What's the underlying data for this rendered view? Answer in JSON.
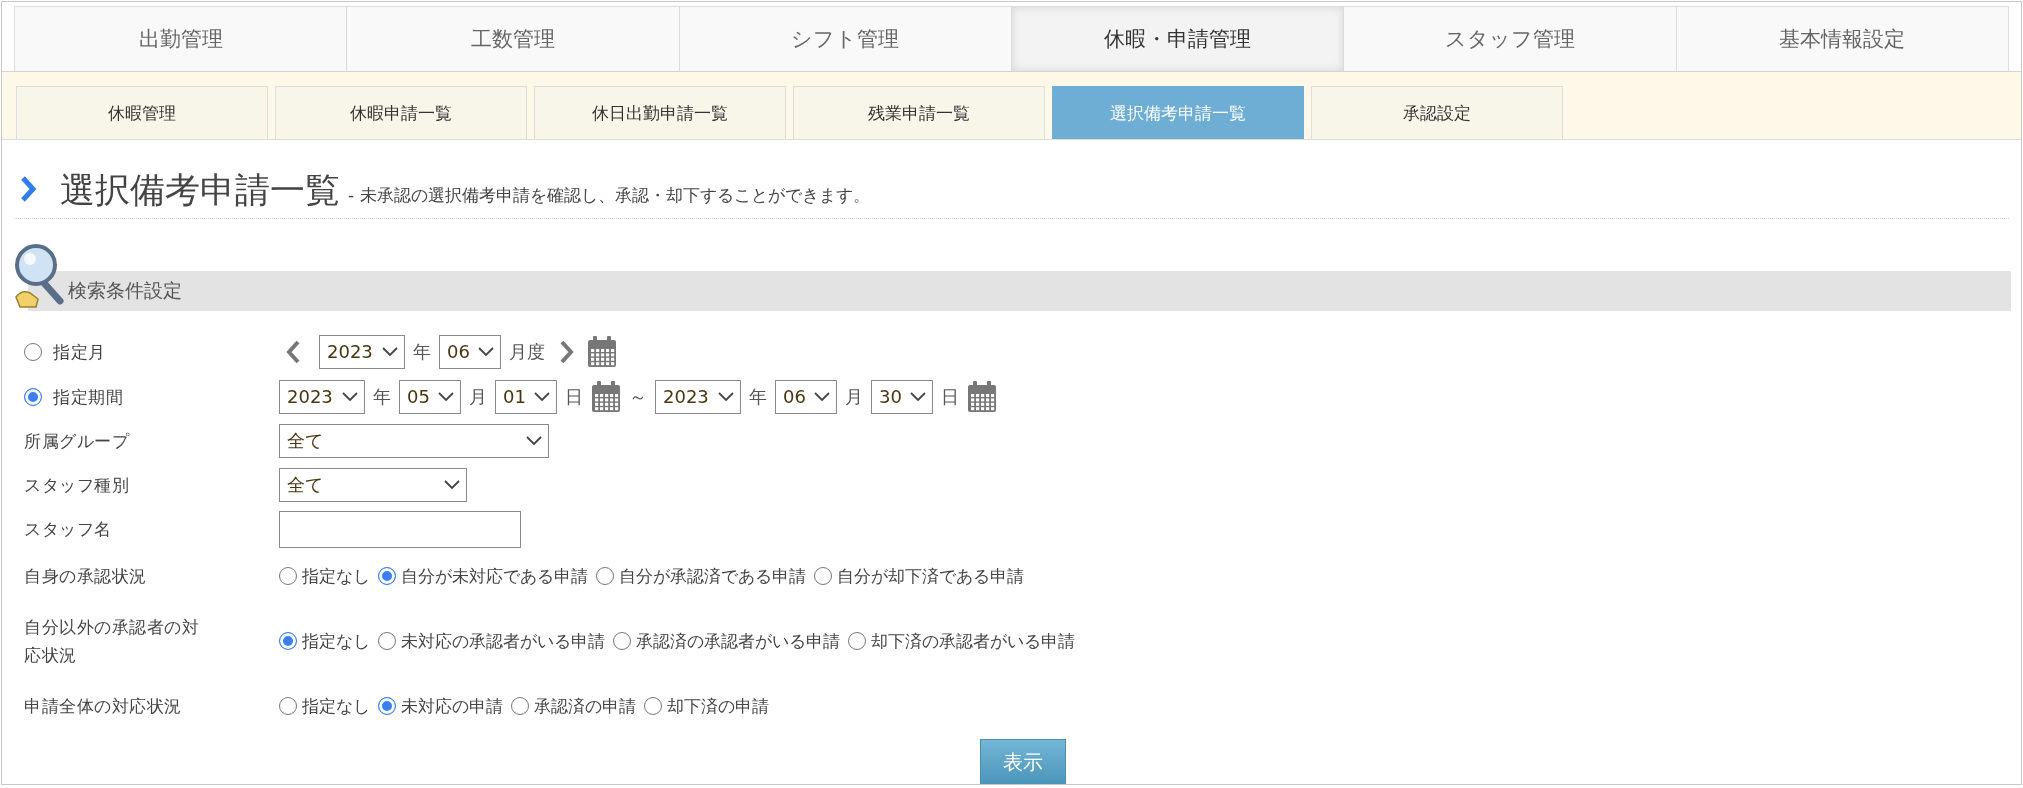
{
  "main_tabs": [
    {
      "label": "出勤管理",
      "selected": false
    },
    {
      "label": "工数管理",
      "selected": false
    },
    {
      "label": "シフト管理",
      "selected": false
    },
    {
      "label": "休暇・申請管理",
      "selected": true
    },
    {
      "label": "スタッフ管理",
      "selected": false
    },
    {
      "label": "基本情報設定",
      "selected": false
    }
  ],
  "sub_tabs": [
    {
      "label": "休暇管理",
      "selected": false
    },
    {
      "label": "休暇申請一覧",
      "selected": false
    },
    {
      "label": "休日出勤申請一覧",
      "selected": false
    },
    {
      "label": "残業申請一覧",
      "selected": false
    },
    {
      "label": "選択備考申請一覧",
      "selected": true
    },
    {
      "label": "承認設定",
      "selected": false
    }
  ],
  "page_title": "選択備考申請一覧",
  "page_description": "- 未承認の選択備考申請を確認し、承認・却下することができます。",
  "search_section": {
    "title": "検索条件設定"
  },
  "period_options": [
    {
      "label": "指定月",
      "selected": false,
      "parts": [
        {
          "kind": "prev"
        },
        {
          "kind": "select",
          "value": "2023"
        },
        {
          "kind": "text",
          "text": "年"
        },
        {
          "kind": "select",
          "value": "06"
        },
        {
          "kind": "text",
          "text": "月度"
        },
        {
          "kind": "next"
        },
        {
          "kind": "calendar"
        }
      ]
    },
    {
      "label": "指定期間",
      "selected": true,
      "parts": [
        {
          "kind": "select",
          "value": "2023"
        },
        {
          "kind": "text",
          "text": "年"
        },
        {
          "kind": "select",
          "value": "05"
        },
        {
          "kind": "text",
          "text": "月"
        },
        {
          "kind": "select",
          "value": "01"
        },
        {
          "kind": "text",
          "text": "日"
        },
        {
          "kind": "calendar"
        },
        {
          "kind": "text",
          "text": "～"
        },
        {
          "kind": "select",
          "value": "2023"
        },
        {
          "kind": "text",
          "text": "年"
        },
        {
          "kind": "select",
          "value": "06"
        },
        {
          "kind": "text",
          "text": "月"
        },
        {
          "kind": "select",
          "value": "30"
        },
        {
          "kind": "text",
          "text": "日"
        },
        {
          "kind": "calendar"
        }
      ]
    }
  ],
  "fields": [
    {
      "kind": "select",
      "label": "所属グループ",
      "value": "全て",
      "wide": true
    },
    {
      "kind": "select",
      "label": "スタッフ種別",
      "value": "全て",
      "wide": false
    },
    {
      "kind": "input",
      "label": "スタッフ名"
    },
    {
      "kind": "radio",
      "label": "自身の承認状況",
      "options": [
        {
          "label": "指定なし",
          "selected": false
        },
        {
          "label": "自分が未対応である申請",
          "selected": true
        },
        {
          "label": "自分が承認済である申請",
          "selected": false
        },
        {
          "label": "自分が却下済である申請",
          "selected": false
        }
      ]
    },
    {
      "kind": "radio",
      "label": "自分以外の承認者の対応状況",
      "options": [
        {
          "label": "指定なし",
          "selected": true
        },
        {
          "label": "未対応の承認者がいる申請",
          "selected": false
        },
        {
          "label": "承認済の承認者がいる申請",
          "selected": false
        },
        {
          "label": "却下済の承認者がいる申請",
          "selected": false
        }
      ]
    },
    {
      "kind": "radio",
      "label": "申請全体の対応状況",
      "options": [
        {
          "label": "指定なし",
          "selected": false
        },
        {
          "label": "未対応の申請",
          "selected": true
        },
        {
          "label": "承認済の申請",
          "selected": false
        },
        {
          "label": "却下済の申請",
          "selected": false
        }
      ]
    }
  ],
  "submit_button": "表示"
}
